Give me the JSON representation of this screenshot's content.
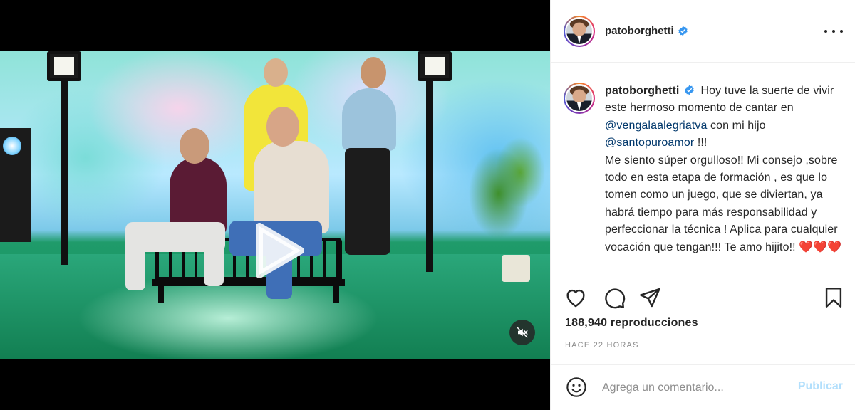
{
  "post": {
    "username": "patoborghetti",
    "verified": true,
    "caption": {
      "line1": "Hoy tuve la suerte de vivir este hermoso momento de cantar en",
      "mention1": "@vengalaalegriatva",
      "line2": "con mi hijo",
      "mention2": "@santopuroamor",
      "line3": "!!!",
      "line4": "Me siento súper orgulloso!! Mi consejo ,sobre todo en esta etapa de formación , es que lo tomen como un juego, que se diviertan, ya habrá tiempo para más responsabilidad y perfeccionar la técnica ! Aplica para cualquier vocación que tengan!!! Te amo hijito!!",
      "hearts": "❤️❤️❤️"
    },
    "views": "188,940 reproducciones",
    "timestamp": "HACE 22 HORAS"
  },
  "comment": {
    "placeholder": "Agrega un comentario...",
    "post_label": "Publicar"
  },
  "icons": {
    "like": "heart-icon",
    "comment": "comment-icon",
    "share": "paper-plane-icon",
    "save": "bookmark-icon",
    "more": "more-horizontal-icon",
    "emoji": "smiley-icon",
    "play": "play-icon",
    "mute": "speaker-muted-icon"
  },
  "colors": {
    "verified": "#3897f0",
    "mention": "#00376b",
    "post_button_disabled": "#b2dffc",
    "muted_text": "#8e8e8e"
  }
}
